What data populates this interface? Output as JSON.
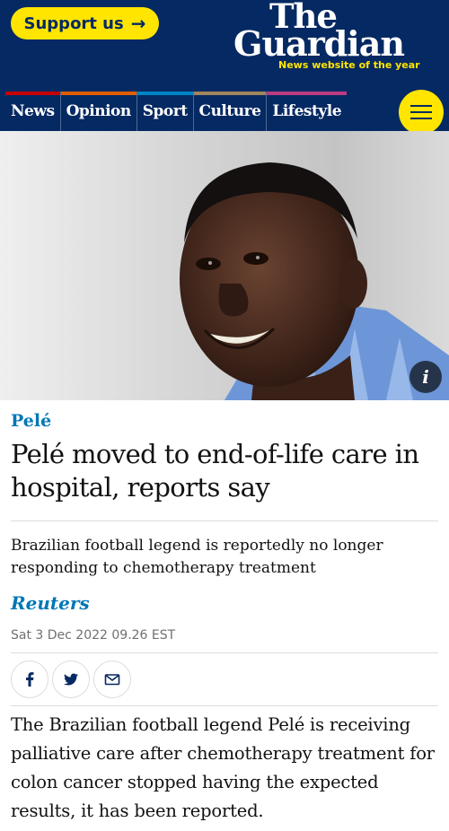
{
  "header": {
    "support_label": "Support us",
    "support_arrow": "→",
    "logo_line1": "The",
    "logo_line2": "Guardian",
    "logo_tagline": "News website of the year"
  },
  "nav": {
    "items": [
      {
        "label": "News",
        "color": "#c70000"
      },
      {
        "label": "Opinion",
        "color": "#e05e00"
      },
      {
        "label": "Sport",
        "color": "#0084c6"
      },
      {
        "label": "Culture",
        "color": "#a1845c"
      },
      {
        "label": "Lifestyle",
        "color": "#bb3b80"
      }
    ],
    "menu_icon": "hamburger-icon"
  },
  "hero": {
    "info_label": "i"
  },
  "article": {
    "kicker": "Pelé",
    "headline": "Pelé moved to end-of-life care in hospital, reports say",
    "standfirst": "Brazilian football legend is reportedly no longer responding to chemotherapy treatment",
    "byline": "Reuters",
    "dateline": "Sat 3 Dec 2022 09.26 EST",
    "share_icons": [
      "facebook-icon",
      "twitter-icon",
      "email-icon"
    ],
    "body": "The Brazilian football legend Pelé is receiving palliative care after chemotherapy treatment for colon cancer stopped having the expected results, it has been reported."
  },
  "colors": {
    "brand_blue": "#052962",
    "accent_yellow": "#ffe500",
    "news_blue": "#0077b6"
  }
}
